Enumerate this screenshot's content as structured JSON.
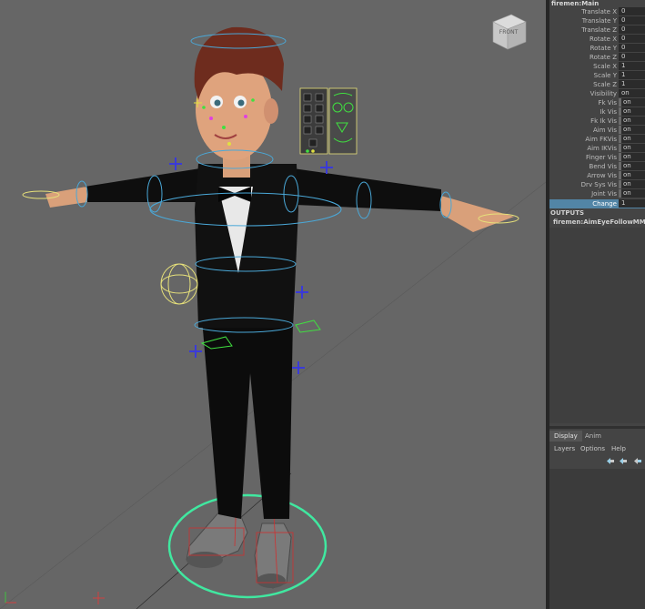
{
  "viewport": {
    "view_cube_label": "FRONT",
    "background_color": "#666666"
  },
  "channel_box": {
    "node_name": "firemen:Main",
    "attributes": [
      {
        "name": "Translate X",
        "value": "0"
      },
      {
        "name": "Translate Y",
        "value": "0"
      },
      {
        "name": "Translate Z",
        "value": "0"
      },
      {
        "name": "Rotate X",
        "value": "0"
      },
      {
        "name": "Rotate Y",
        "value": "0"
      },
      {
        "name": "Rotate Z",
        "value": "0"
      },
      {
        "name": "Scale X",
        "value": "1"
      },
      {
        "name": "Scale Y",
        "value": "1"
      },
      {
        "name": "Scale Z",
        "value": "1"
      },
      {
        "name": "Visibility",
        "value": "on"
      },
      {
        "name": "Fk Vis",
        "value": "on"
      },
      {
        "name": "Ik Vis",
        "value": "on"
      },
      {
        "name": "Fk Ik Vis",
        "value": "on"
      },
      {
        "name": "Aim Vis",
        "value": "on"
      },
      {
        "name": "Aim FKVis",
        "value": "on"
      },
      {
        "name": "Aim IKVis",
        "value": "on"
      },
      {
        "name": "Finger Vis",
        "value": "on"
      },
      {
        "name": "Bend Vis",
        "value": "on"
      },
      {
        "name": "Arrow Vis",
        "value": "on"
      },
      {
        "name": "Drv Sys Vis",
        "value": "on"
      },
      {
        "name": "Joint Vis",
        "value": "on"
      },
      {
        "name": "Change",
        "value": "1"
      }
    ],
    "selected_attribute": "Change",
    "outputs_label": "OUTPUTS",
    "output_node": "firemen:AimEyeFollowMMStatic_I"
  },
  "layer_editor": {
    "tabs": [
      "Display",
      "Anim"
    ],
    "active_tab": "Display",
    "menu": [
      "Layers",
      "Options",
      "Help"
    ]
  },
  "colors": {
    "selection": "#5285a6",
    "control_curve_blue": "#4aa8d8",
    "control_curve_yellow": "#e6e07a",
    "locator_blue": "#3a3ad8",
    "ground_ring": "#40e8a0"
  }
}
